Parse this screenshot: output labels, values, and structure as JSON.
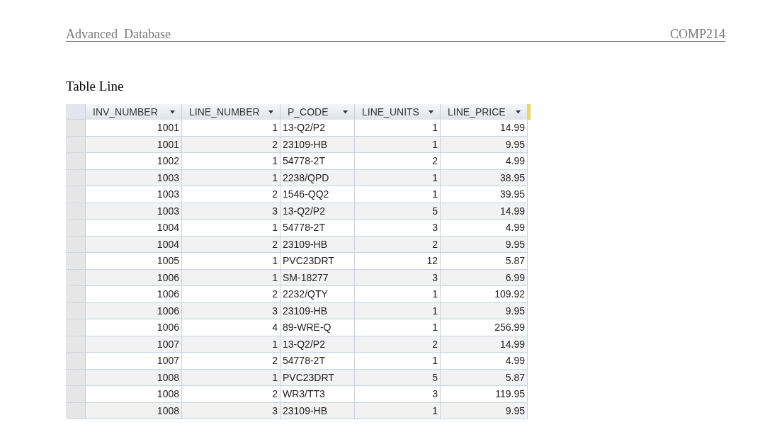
{
  "header": {
    "left": "Advanced  Database",
    "right": "COMP214"
  },
  "heading": "Table Line",
  "table": {
    "columns": [
      {
        "label": "INV_NUMBER",
        "kind": "number"
      },
      {
        "label": "LINE_NUMBER",
        "kind": "number"
      },
      {
        "label": "P_CODE",
        "kind": "text"
      },
      {
        "label": "LINE_UNITS",
        "kind": "number"
      },
      {
        "label": "LINE_PRICE",
        "kind": "number"
      }
    ],
    "rows": [
      [
        "1001",
        "1",
        "13-Q2/P2",
        "1",
        "14.99"
      ],
      [
        "1001",
        "2",
        "23109-HB",
        "1",
        "9.95"
      ],
      [
        "1002",
        "1",
        "54778-2T",
        "2",
        "4.99"
      ],
      [
        "1003",
        "1",
        "2238/QPD",
        "1",
        "38.95"
      ],
      [
        "1003",
        "2",
        "1546-QQ2",
        "1",
        "39.95"
      ],
      [
        "1003",
        "3",
        "13-Q2/P2",
        "5",
        "14.99"
      ],
      [
        "1004",
        "1",
        "54778-2T",
        "3",
        "4.99"
      ],
      [
        "1004",
        "2",
        "23109-HB",
        "2",
        "9.95"
      ],
      [
        "1005",
        "1",
        "PVC23DRT",
        "12",
        "5.87"
      ],
      [
        "1006",
        "1",
        "SM-18277",
        "3",
        "6.99"
      ],
      [
        "1006",
        "2",
        "2232/QTY",
        "1",
        "109.92"
      ],
      [
        "1006",
        "3",
        "23109-HB",
        "1",
        "9.95"
      ],
      [
        "1006",
        "4",
        "89-WRE-Q",
        "1",
        "256.99"
      ],
      [
        "1007",
        "1",
        "13-Q2/P2",
        "2",
        "14.99"
      ],
      [
        "1007",
        "2",
        "54778-2T",
        "1",
        "4.99"
      ],
      [
        "1008",
        "1",
        "PVC23DRT",
        "5",
        "5.87"
      ],
      [
        "1008",
        "2",
        "WR3/TT3",
        "3",
        "119.95"
      ],
      [
        "1008",
        "3",
        "23109-HB",
        "1",
        "9.95"
      ]
    ]
  }
}
